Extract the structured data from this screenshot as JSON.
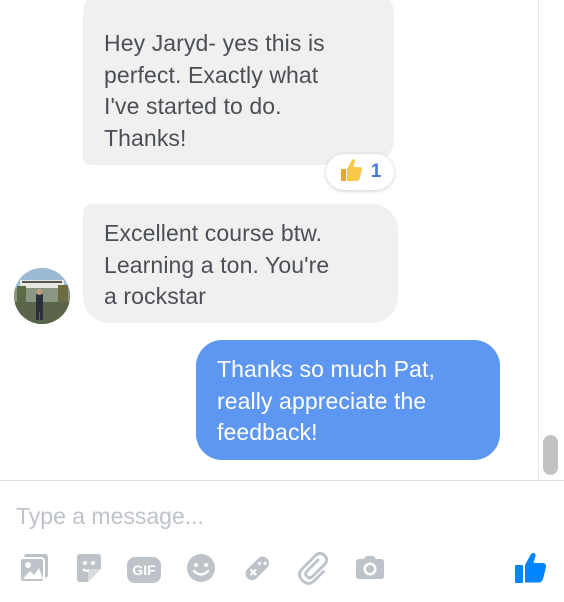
{
  "messages": [
    {
      "direction": "incoming",
      "text": "Hey Jaryd- yes this is\nperfect. Exactly what\nI've started to do.\nThanks!",
      "reaction": {
        "icon": "thumbs-up-icon",
        "count": "1"
      }
    },
    {
      "direction": "incoming",
      "text": "Excellent course btw.\nLearning a ton. You're\na rockstar"
    },
    {
      "direction": "outgoing",
      "text": "Thanks so much Pat,\nreally appreciate the\nfeedback!"
    }
  ],
  "composer": {
    "placeholder": "Type a message..."
  },
  "toolbar": {
    "icons": [
      "photo-icon",
      "sticker-icon",
      "gif-icon",
      "emoji-icon",
      "game-icon",
      "attachment-icon",
      "camera-icon"
    ],
    "gif_label": "GIF",
    "like_icon": "thumbs-up-icon"
  },
  "colors": {
    "incoming_bubble": "#f1f0f0",
    "outgoing_bubble": "#5e97f2",
    "icon_gray": "#bec3c9",
    "accent_blue": "#0084ff",
    "reaction_yellow": "#f7c84a"
  }
}
